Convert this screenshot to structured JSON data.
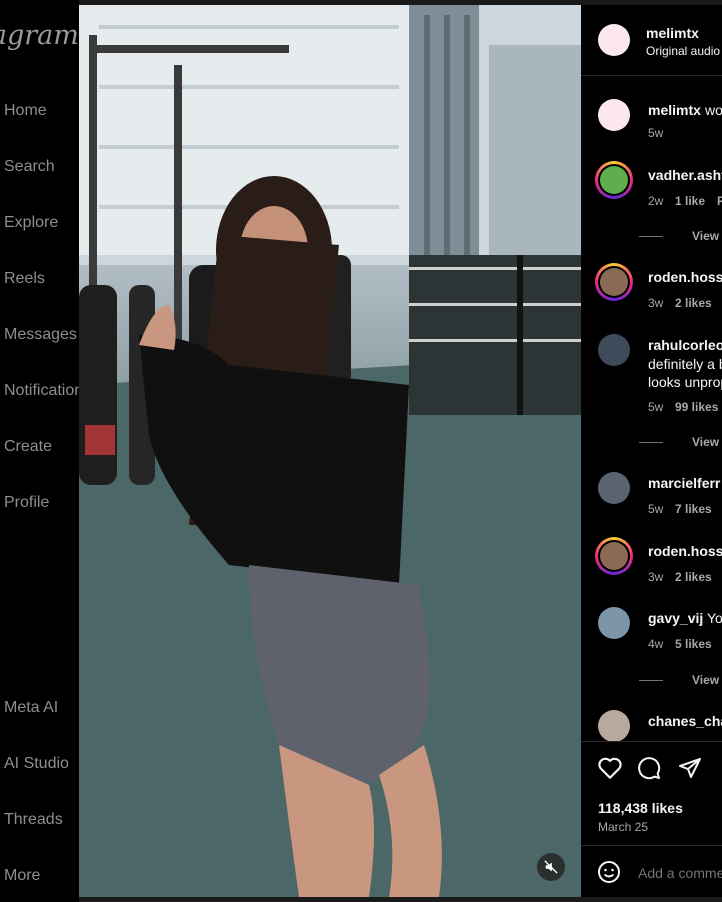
{
  "sidebar": {
    "logo": "tagram",
    "items": [
      {
        "label": "Home"
      },
      {
        "label": "Search"
      },
      {
        "label": "Explore"
      },
      {
        "label": "Reels"
      },
      {
        "label": "Messages"
      },
      {
        "label": "Notification"
      },
      {
        "label": "Create"
      },
      {
        "label": "Profile"
      }
    ],
    "bottom_items": [
      {
        "label": "Meta AI"
      },
      {
        "label": "AI Studio"
      },
      {
        "label": "Threads"
      },
      {
        "label": "More"
      }
    ]
  },
  "post": {
    "author": "melimtx",
    "audio": "Original audio",
    "caption_author": "melimtx",
    "caption_text": "wo",
    "caption_time": "5w",
    "likes": "118,438 likes",
    "date": "March 25",
    "add_comment_placeholder": "Add a comme"
  },
  "comments": [
    {
      "user": "vadher.asht",
      "text": "",
      "time": "2w",
      "likes": "1 like",
      "reply": "R"
    },
    {
      "view_replies": "View"
    },
    {
      "user": "roden.hoss",
      "text": "",
      "time": "3w",
      "likes": "2 likes"
    },
    {
      "user": "rahulcorleo",
      "line1": "definitely a b",
      "line2": "looks unprop",
      "time": "5w",
      "likes": "99 likes"
    },
    {
      "view_replies": "View"
    },
    {
      "user": "marcielferr",
      "text": "",
      "time": "5w",
      "likes": "7 likes"
    },
    {
      "user": "roden.hoss",
      "text": "",
      "time": "3w",
      "likes": "2 likes"
    },
    {
      "user": "gavy_vij",
      "text": "Yo",
      "time": "4w",
      "likes": "5 likes"
    },
    {
      "view_replies": "View"
    },
    {
      "user": "chanes_cha",
      "text": ""
    }
  ]
}
